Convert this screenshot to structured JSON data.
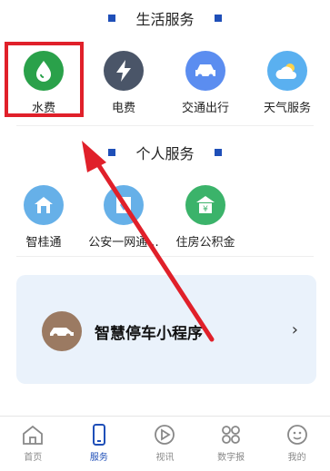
{
  "life_services": {
    "title": "生活服务",
    "items": [
      {
        "label": "水费",
        "icon": "water-drop-icon",
        "color": "#2aa14a"
      },
      {
        "label": "电费",
        "icon": "lightning-icon",
        "color": "#4a5568"
      },
      {
        "label": "交通出行",
        "icon": "car-icon",
        "color": "#5b8df0"
      },
      {
        "label": "天气服务",
        "icon": "weather-icon",
        "color": "#5ab0f0"
      }
    ]
  },
  "personal_services": {
    "title": "个人服务",
    "items": [
      {
        "label": "智桂通",
        "icon": "home-icon",
        "color": "#66b0e8"
      },
      {
        "label": "公安一网通...",
        "icon": "police-icon",
        "color": "#66b0e8"
      },
      {
        "label": "住房公积金",
        "icon": "fund-icon",
        "color": "#3bb36a"
      }
    ]
  },
  "card": {
    "title": "智慧停车小程序",
    "chevron": "›"
  },
  "tabbar": {
    "items": [
      {
        "label": "首页",
        "icon": "home-outline-icon"
      },
      {
        "label": "服务",
        "icon": "phone-icon",
        "active": true
      },
      {
        "label": "视讯",
        "icon": "play-icon"
      },
      {
        "label": "数字报",
        "icon": "grid-icon"
      },
      {
        "label": "我的",
        "icon": "profile-icon"
      }
    ]
  },
  "colors": {
    "accent": "#1f4fb8",
    "highlight": "#e0202a",
    "card_bg": "#eaf2fb"
  }
}
